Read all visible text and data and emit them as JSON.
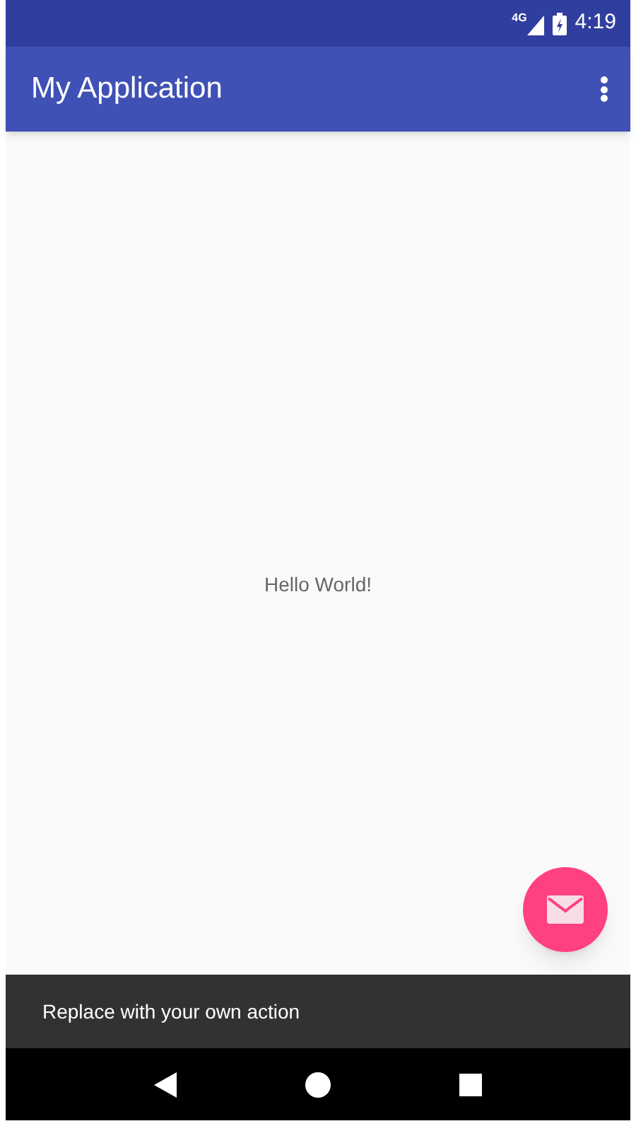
{
  "status_bar": {
    "network": "4G",
    "time": "4:19"
  },
  "app_bar": {
    "title": "My Application"
  },
  "content": {
    "text": "Hello World!"
  },
  "snackbar": {
    "text": "Replace with your own action"
  }
}
